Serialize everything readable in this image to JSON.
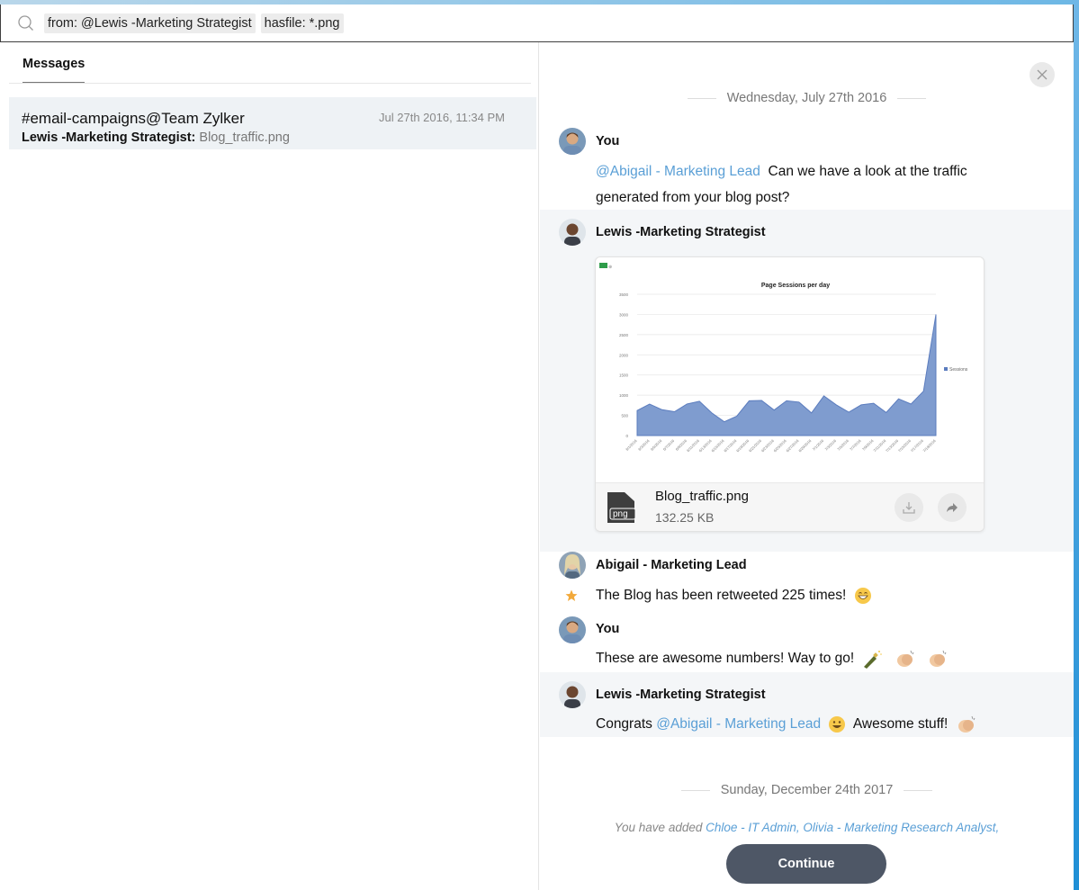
{
  "search": {
    "chips": [
      "from: @Lewis -Marketing Strategist",
      "hasfile: *.png"
    ]
  },
  "left": {
    "tab_label": "Messages",
    "result": {
      "channel": "#email-campaigns@Team Zylker",
      "time": "Jul 27th 2016, 11:34 PM",
      "sender": "Lewis -Marketing Strategist:",
      "file": "Blog_traffic.png"
    }
  },
  "chat": {
    "date1": "Wednesday, July 27th 2016",
    "msg1": {
      "sender": "You",
      "mention": "@Abigail - Marketing Lead",
      "text_a": "Can we have a look at the traffic",
      "text_b": "generated from your blog post?"
    },
    "msg2": {
      "sender": "Lewis -Marketing Strategist",
      "attachment": {
        "name": "Blog_traffic.png",
        "size": "132.25 KB",
        "badge": "png"
      }
    },
    "msg3": {
      "sender": "Abigail - Marketing Lead",
      "text": "The Blog has been retweeted 225 times!"
    },
    "msg4": {
      "sender": "You",
      "text": "These are awesome numbers! Way to go!"
    },
    "msg5": {
      "sender": "Lewis -Marketing Strategist",
      "prefix": "Congrats",
      "mention": "@Abigail - Marketing Lead",
      "suffix": "Awesome stuff!"
    },
    "date2": "Sunday, December 24th 2017",
    "system": {
      "prefix": "You have added ",
      "names": "Chloe - IT Admin, Olivia - Marketing Research Analyst,"
    },
    "continue_label": "Continue"
  },
  "colors": {
    "mention": "#5a9fd6",
    "continue_button": "#4e5766",
    "star": "#f2a93b"
  },
  "chart_data": {
    "type": "area",
    "title": "Page Sessions per day",
    "legend": "Sessions",
    "legend_position": "right",
    "ylim": [
      0,
      3500
    ],
    "yticks": [
      "3500",
      "3000",
      "2500",
      "2000",
      "1500",
      "1000",
      "500",
      "0"
    ],
    "x": [
      "6/1/2016",
      "6/3/2016",
      "6/5/2016",
      "6/7/2016",
      "6/9/2016",
      "6/11/2016",
      "6/13/2016",
      "6/15/2016",
      "6/17/2016",
      "6/19/2016",
      "6/21/2016",
      "6/23/2016",
      "6/25/2016",
      "6/27/2016",
      "6/29/2016",
      "7/1/2016",
      "7/3/2016",
      "7/5/2016",
      "7/7/2016",
      "7/9/2016",
      "7/11/2016",
      "7/13/2016",
      "7/15/2016",
      "7/17/2016",
      "7/19/2016"
    ],
    "values": [
      620,
      780,
      640,
      590,
      780,
      850,
      560,
      340,
      480,
      860,
      870,
      630,
      860,
      830,
      560,
      980,
      760,
      580,
      760,
      800,
      570,
      910,
      780,
      1100,
      3000
    ]
  }
}
